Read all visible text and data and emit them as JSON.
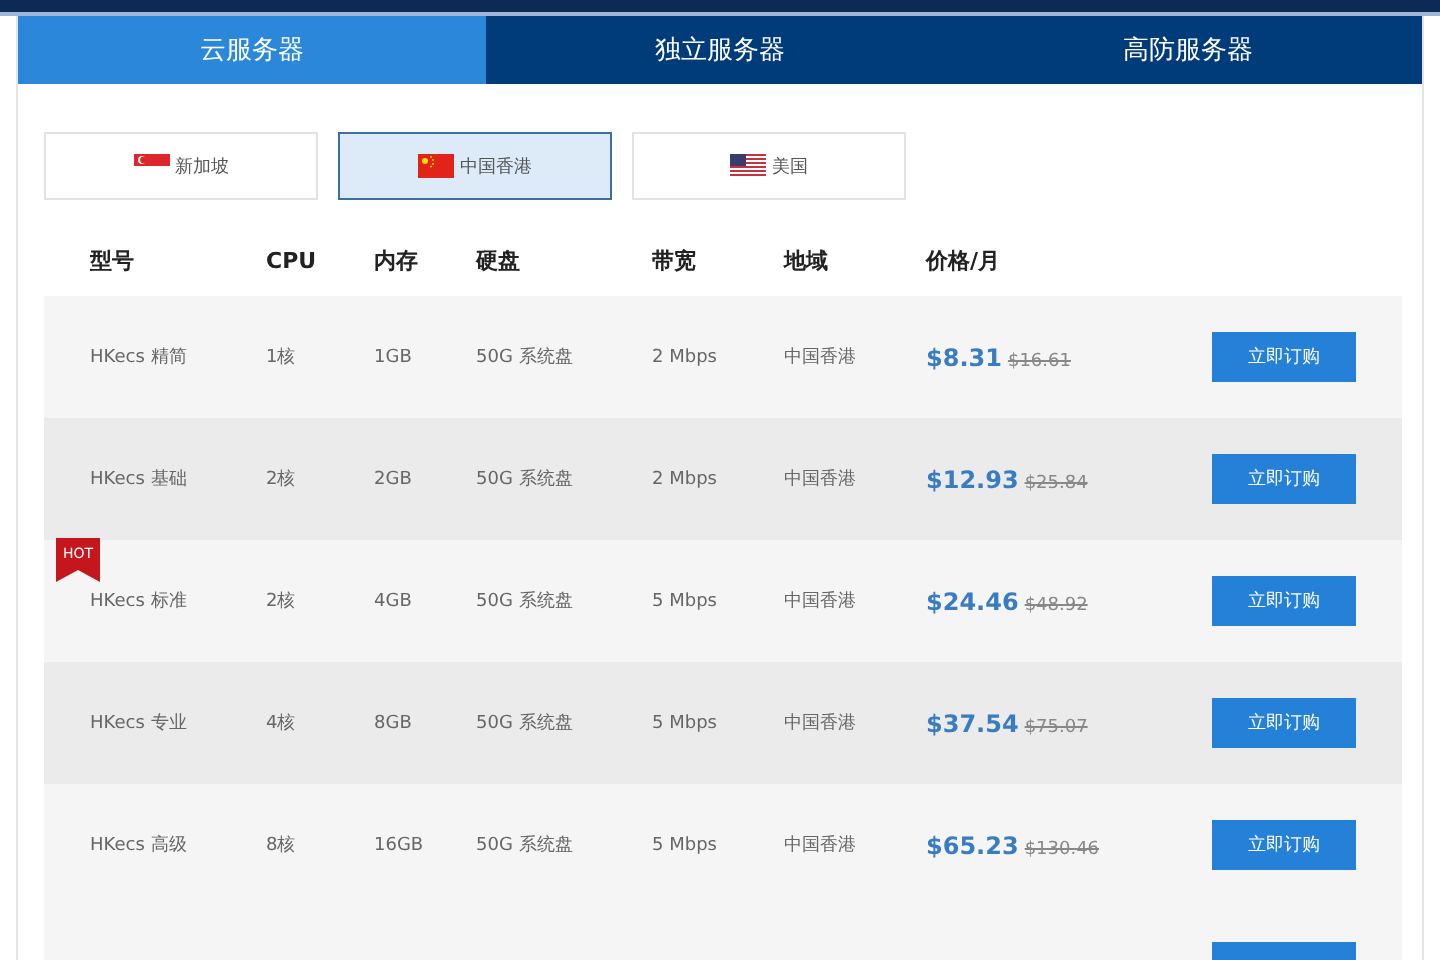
{
  "tabs": [
    {
      "label": "云服务器",
      "selected": true
    },
    {
      "label": "独立服务器",
      "selected": false
    },
    {
      "label": "高防服务器",
      "selected": false
    }
  ],
  "regions": [
    {
      "label": "新加坡",
      "kind": "sg",
      "selected": false
    },
    {
      "label": "中国香港",
      "kind": "cn",
      "selected": true
    },
    {
      "label": "美国",
      "kind": "us",
      "selected": false
    }
  ],
  "table": {
    "columns": [
      "型号",
      "CPU",
      "内存",
      "硬盘",
      "带宽",
      "地域",
      "价格/月"
    ],
    "rows": [
      {
        "model": "HKecs 精简",
        "cpu": "1核",
        "memory": "1GB",
        "disk": "50G 系统盘",
        "bandwidth": "2 Mbps",
        "region": "中国香港",
        "price": "$8.31",
        "old_price": "$16.61",
        "button": "立即订购"
      },
      {
        "model": "HKecs 基础",
        "cpu": "2核",
        "memory": "2GB",
        "disk": "50G 系统盘",
        "bandwidth": "2 Mbps",
        "region": "中国香港",
        "price": "$12.93",
        "old_price": "$25.84",
        "button": "立即订购"
      },
      {
        "model": "HKecs 标准",
        "cpu": "2核",
        "memory": "4GB",
        "disk": "50G 系统盘",
        "bandwidth": "5 Mbps",
        "region": "中国香港",
        "price": "$24.46",
        "old_price": "$48.92",
        "badge": "HOT",
        "button": "立即订购"
      },
      {
        "model": "HKecs 专业",
        "cpu": "4核",
        "memory": "8GB",
        "disk": "50G 系统盘",
        "bandwidth": "5 Mbps",
        "region": "中国香港",
        "price": "$37.54",
        "old_price": "$75.07",
        "button": "立即订购"
      },
      {
        "model": "HKecs 高级",
        "cpu": "8核",
        "memory": "16GB",
        "disk": "50G 系统盘",
        "bandwidth": "5 Mbps",
        "region": "中国香港",
        "price": "$65.23",
        "old_price": "$130.46",
        "button": "立即订购"
      }
    ]
  }
}
